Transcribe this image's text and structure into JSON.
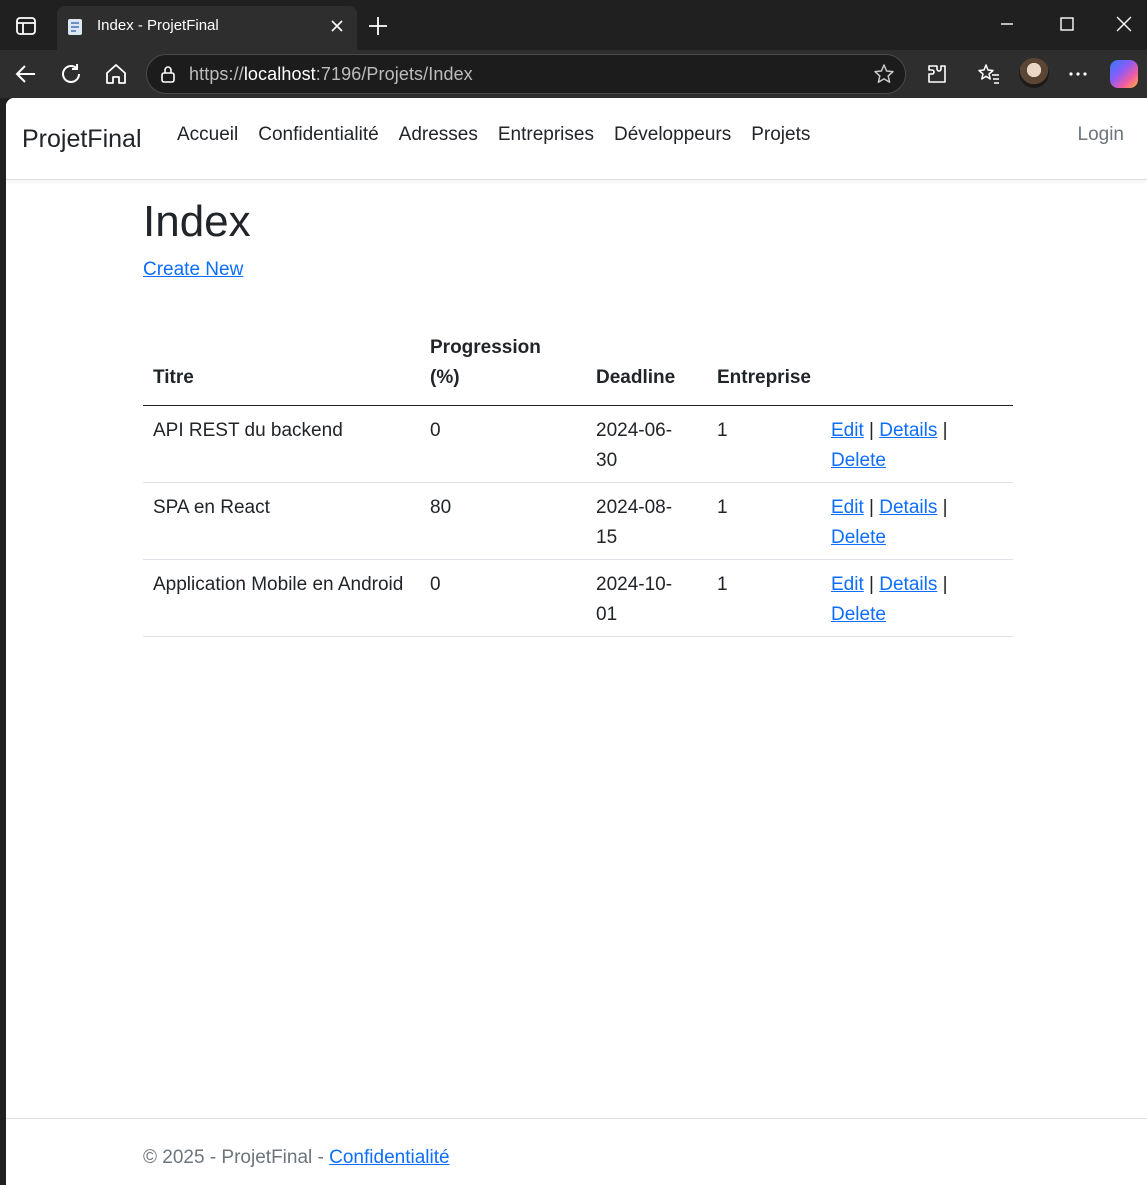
{
  "browser": {
    "tab_title": "Index - ProjetFinal",
    "url_scheme": "https://",
    "url_host": "localhost",
    "url_rest": ":7196/Projets/Index"
  },
  "navbar": {
    "brand": "ProjetFinal",
    "links": [
      "Accueil",
      "Confidentialité",
      "Adresses",
      "Entreprises",
      "Développeurs",
      "Projets"
    ],
    "login": "Login"
  },
  "main": {
    "title": "Index",
    "create_link": "Create New",
    "table": {
      "headers": {
        "titre": "Titre",
        "progression_line1": "Progression",
        "progression_line2": "(%)",
        "deadline": "Deadline",
        "entreprise": "Entreprise"
      },
      "rows": [
        {
          "titre": "API REST du backend",
          "progression": "0",
          "deadline_1": "2024-06-",
          "deadline_2": "30",
          "entreprise": "1"
        },
        {
          "titre": "SPA en React",
          "progression": "80",
          "deadline_1": "2024-08-",
          "deadline_2": "15",
          "entreprise": "1"
        },
        {
          "titre": "Application Mobile en Android",
          "progression": "0",
          "deadline_1": "2024-10-",
          "deadline_2": "01",
          "entreprise": "1"
        }
      ],
      "actions": {
        "edit": "Edit",
        "details": "Details",
        "delete": "Delete",
        "separator": "|"
      }
    }
  },
  "footer": {
    "text": "© 2025 - ProjetFinal - ",
    "link": "Confidentialité"
  }
}
